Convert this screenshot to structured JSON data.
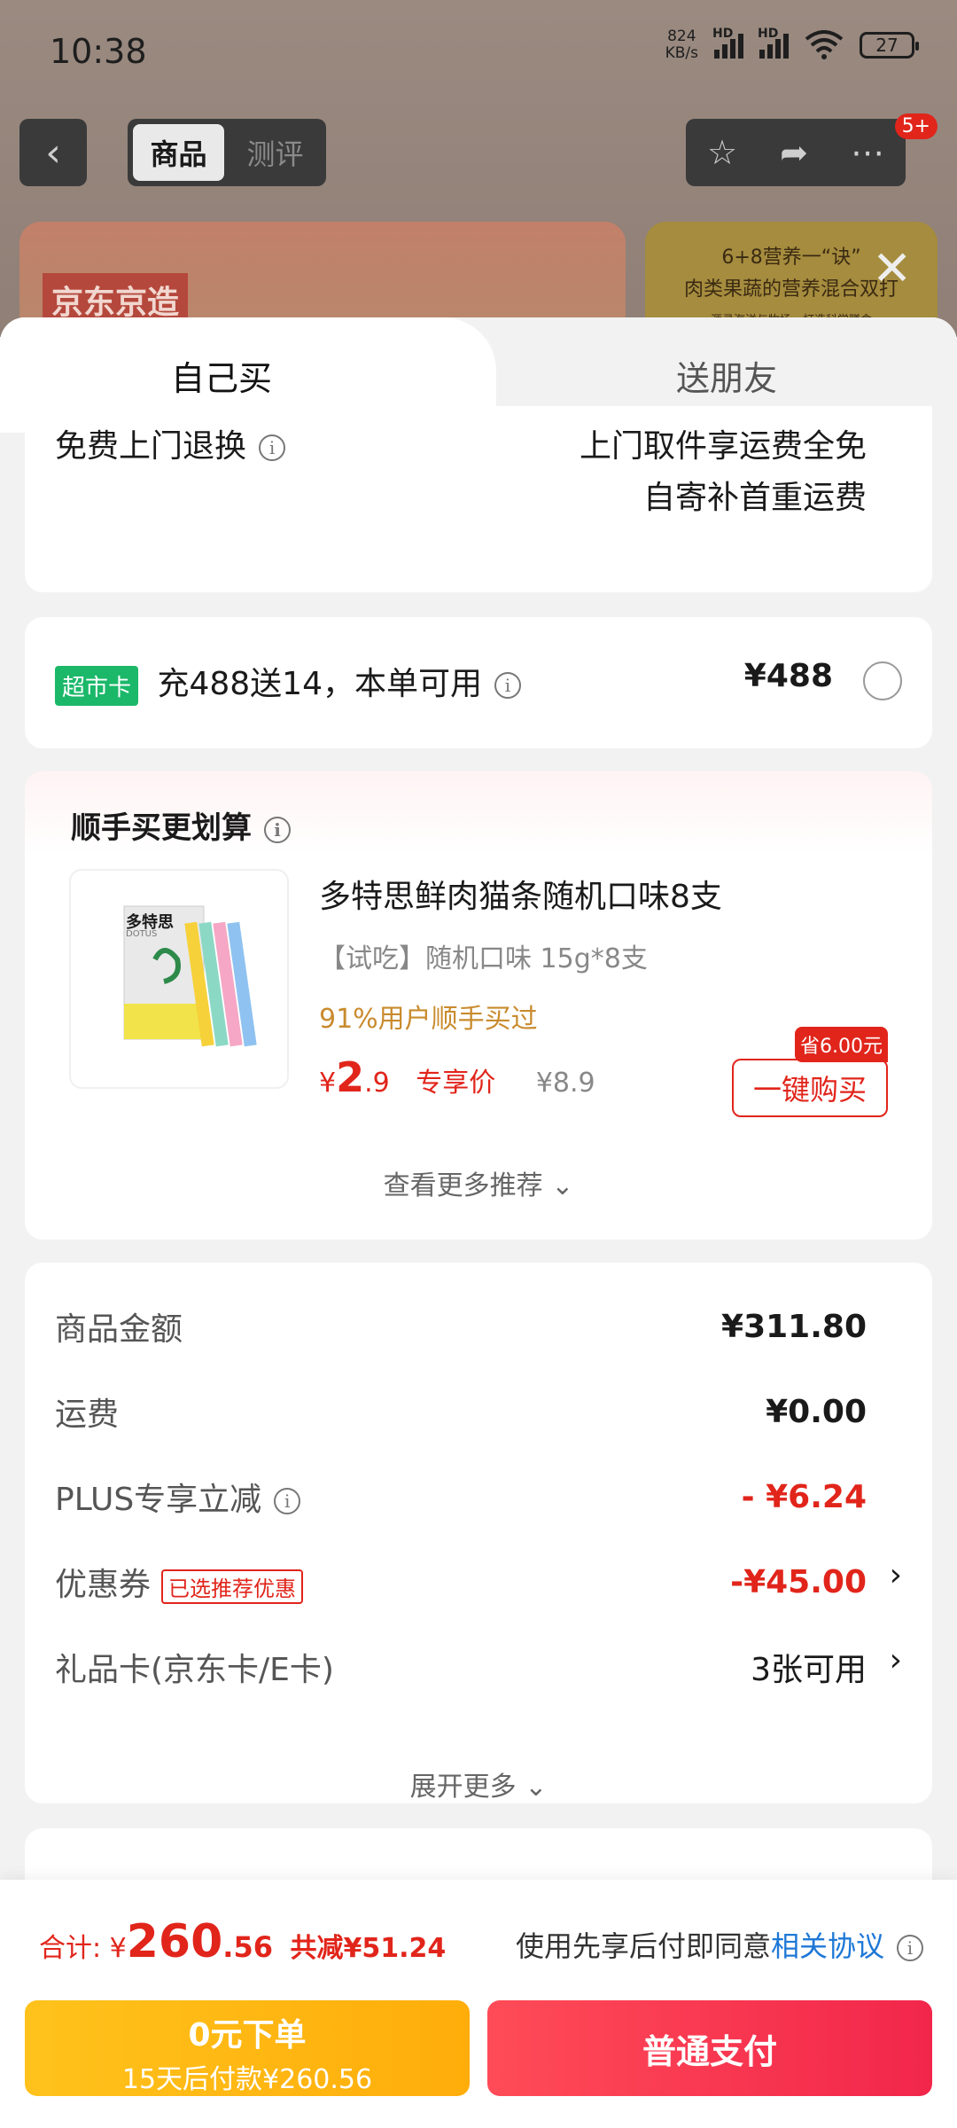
{
  "status_bar": {
    "time": "10:38",
    "speed_value": "824",
    "speed_unit": "KB/s",
    "hd1": "HD",
    "hd2": "HD",
    "battery": "27"
  },
  "header": {
    "tabs": [
      "商品",
      "测评"
    ],
    "notification_count": "5+"
  },
  "background": {
    "brand_tag": "京东京造",
    "promo_line1": "6+8营养一“诀”",
    "promo_line2": "肉类果蔬的营养混合双打",
    "promo_line3": "源寻海洋与牧场，打造科学膳食"
  },
  "sheet_tabs": {
    "self": "自己买",
    "gift": "送朋友"
  },
  "return_section": {
    "label": "免费上门退换",
    "line1": "上门取件享运费全免",
    "line2": "自寄补首重运费"
  },
  "supermarket_card": {
    "tag": "超市卡",
    "text": "充488送14，本单可用",
    "price": "¥488"
  },
  "addon_section": {
    "title": "顺手买更划算",
    "product_name": "多特思鲜肉猫条随机口味8支",
    "product_spec": "【试吃】随机口味 15g*8支",
    "bought_text": "91%用户顺手买过",
    "price_symbol": "¥",
    "price_int": "2",
    "price_dec": ".9",
    "exclusive_label": "专享价",
    "original_price": "¥8.9",
    "save_tag": "省6.00元",
    "buy_button": "一键购买",
    "more_label": "查看更多推荐",
    "product_box_text": "多特思",
    "product_box_brand": "DOTUS"
  },
  "fees": {
    "rows": [
      {
        "label": "商品金额",
        "value": "¥311.80"
      },
      {
        "label": "运费",
        "value": "¥0.00"
      },
      {
        "label": "PLUS专享立减",
        "value": "- ¥6.24"
      },
      {
        "label": "优惠券",
        "tag": "已选推荐优惠",
        "value": "-¥45.00"
      },
      {
        "label": "礼品卡(京东卡/E卡)",
        "value": "3张可用"
      }
    ],
    "expand_label": "展开更多"
  },
  "footer": {
    "total_label": "合计:",
    "total_symbol": "¥",
    "total_int": "260",
    "total_dec": ".56",
    "discount": "共减¥51.24",
    "agreement_text": "使用先享后付即同意",
    "agreement_link": "相关协议",
    "later_title": "0元下单",
    "later_sub": "15天后付款¥260.56",
    "pay_button": "普通支付"
  },
  "colors": {
    "accent_red": "#e1251b",
    "green_tag": "#1bb86a",
    "link_blue": "#1e78d6",
    "later_yellow": "#ffb612",
    "pay_red": "#f2264b"
  }
}
